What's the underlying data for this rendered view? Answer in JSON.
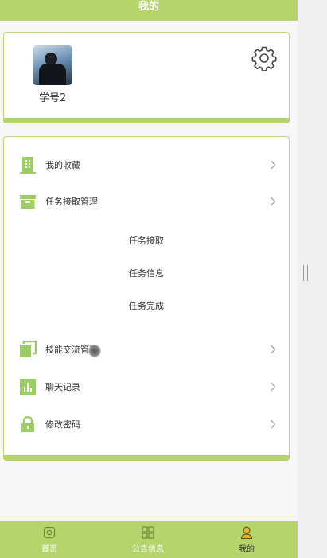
{
  "header": {
    "title": "我的"
  },
  "profile": {
    "username": "学号2",
    "settings_icon": "gear-icon"
  },
  "menu": {
    "items": [
      {
        "label": "我的收藏",
        "icon": "building-icon"
      },
      {
        "label": "任务接取管理",
        "icon": "archive-box-icon"
      },
      {
        "label": "技能交流管理",
        "icon": "copy-icon"
      },
      {
        "label": "聊天记录",
        "icon": "bar-chart-icon"
      },
      {
        "label": "修改密码",
        "icon": "lock-icon"
      }
    ],
    "sub_items": [
      "任务接取",
      "任务信息",
      "任务完成"
    ]
  },
  "tabbar": {
    "tabs": [
      {
        "label": "首页",
        "icon": "home-icon"
      },
      {
        "label": "公告信息",
        "icon": "grid-icon"
      },
      {
        "label": "我的",
        "icon": "user-icon",
        "active": true
      }
    ]
  },
  "colors": {
    "accent": "#b5d46b",
    "icon_green": "#9ccc65",
    "text": "#333333",
    "active_tab_icon": "#e3b21e"
  }
}
